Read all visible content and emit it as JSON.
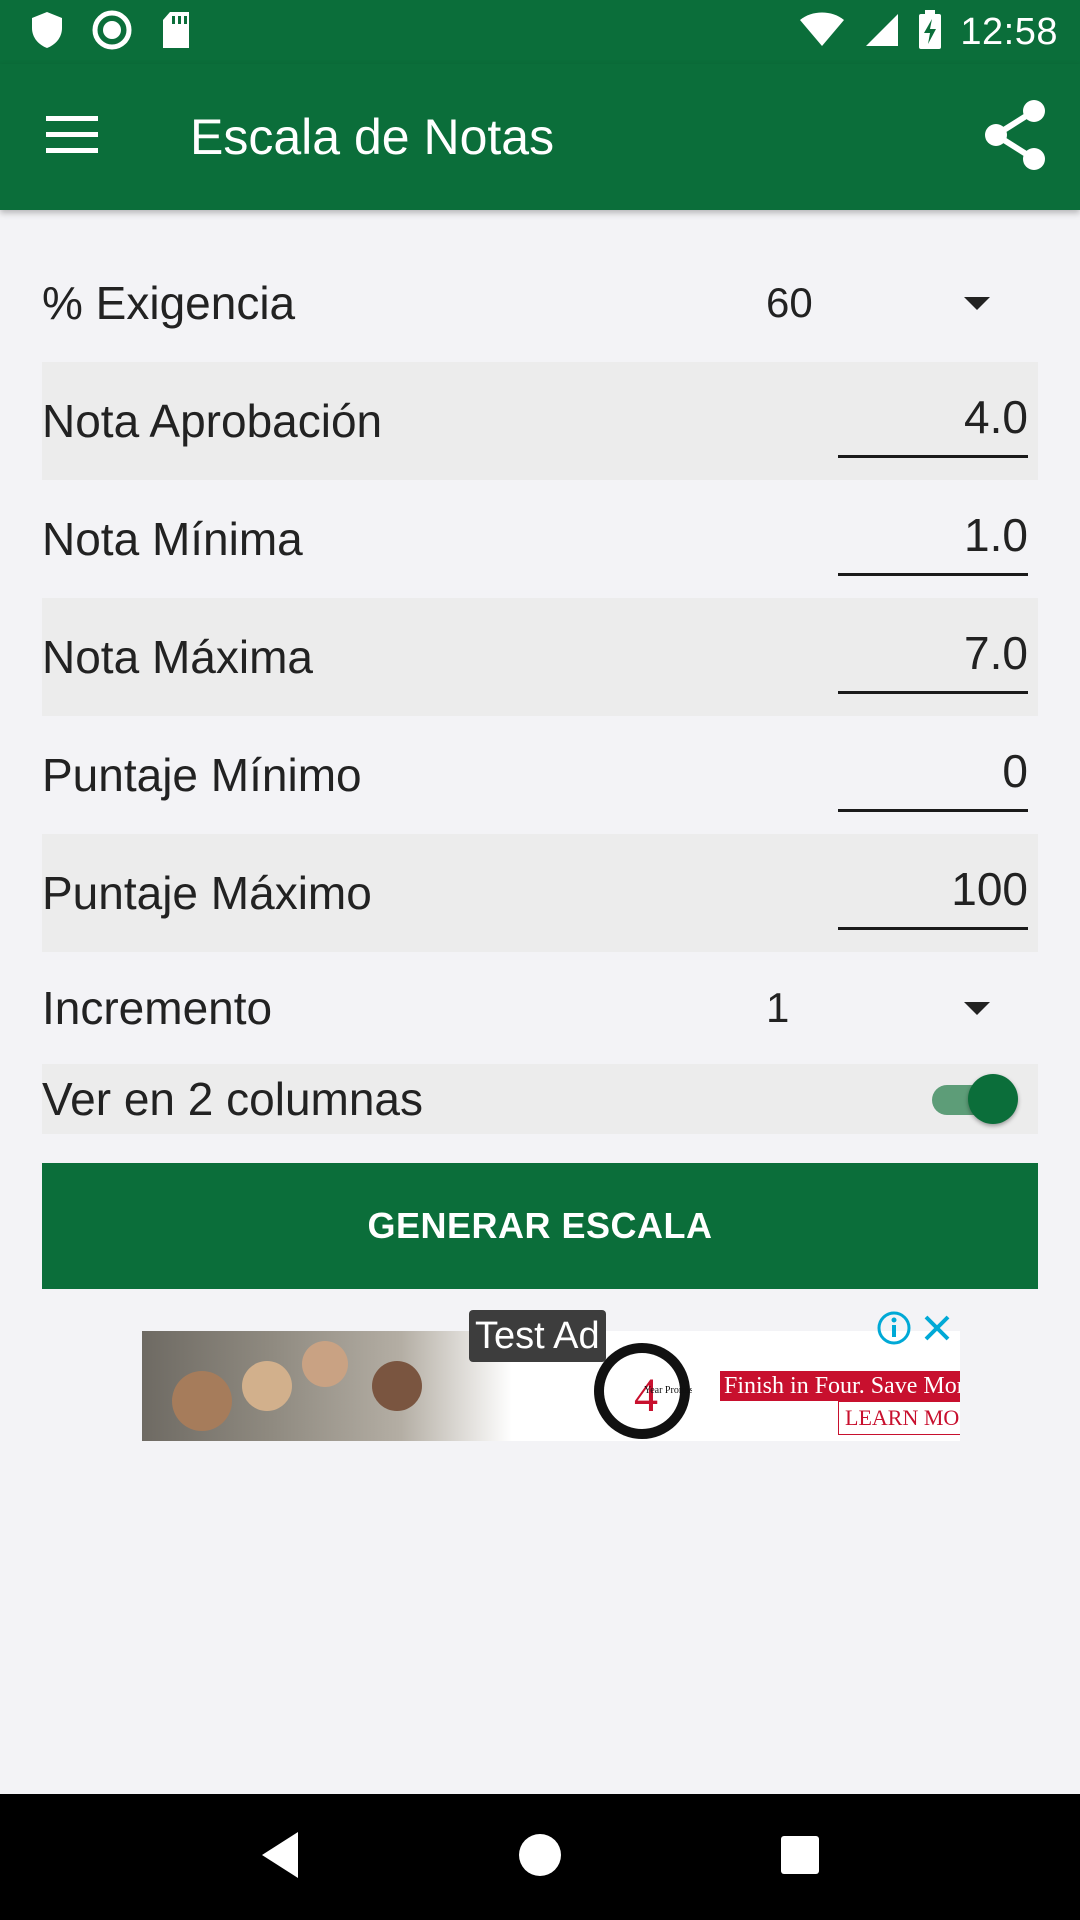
{
  "status_bar": {
    "time": "12:58",
    "icons": [
      "shield-icon",
      "record-icon",
      "sd-card-icon",
      "wifi-icon",
      "signal-icon",
      "battery-charging-icon"
    ]
  },
  "app_bar": {
    "title": "Escala de Notas",
    "menu_icon": "hamburger-menu-icon",
    "share_icon": "share-icon"
  },
  "form": {
    "exigencia": {
      "label": "% Exigencia",
      "value": "60"
    },
    "nota_aprobacion": {
      "label": "Nota Aprobación",
      "value": "4.0"
    },
    "nota_minima": {
      "label": "Nota Mínima",
      "value": "1.0"
    },
    "nota_maxima": {
      "label": "Nota Máxima",
      "value": "7.0"
    },
    "puntaje_minimo": {
      "label": "Puntaje Mínimo",
      "value": "0"
    },
    "puntaje_maximo": {
      "label": "Puntaje Máximo",
      "value": "100"
    },
    "incremento": {
      "label": "Incremento",
      "value": "1"
    },
    "dos_columnas": {
      "label": "Ver en 2 columnas",
      "enabled": true
    }
  },
  "generate_button": {
    "label": "GENERAR ESCALA"
  },
  "ad": {
    "label": "Test Ad",
    "headline": "Finish in Four. Save Mor",
    "cta": "LEARN MOR",
    "seal_number": "4",
    "seal_text": "Year Promise"
  },
  "nav_bar": {
    "icons": [
      "back-icon",
      "home-icon",
      "recents-icon"
    ]
  },
  "colors": {
    "primary": "#0b6e3a",
    "background": "#f3f3f6",
    "shaded_row": "#ececec",
    "ad_red": "#c8102e"
  }
}
